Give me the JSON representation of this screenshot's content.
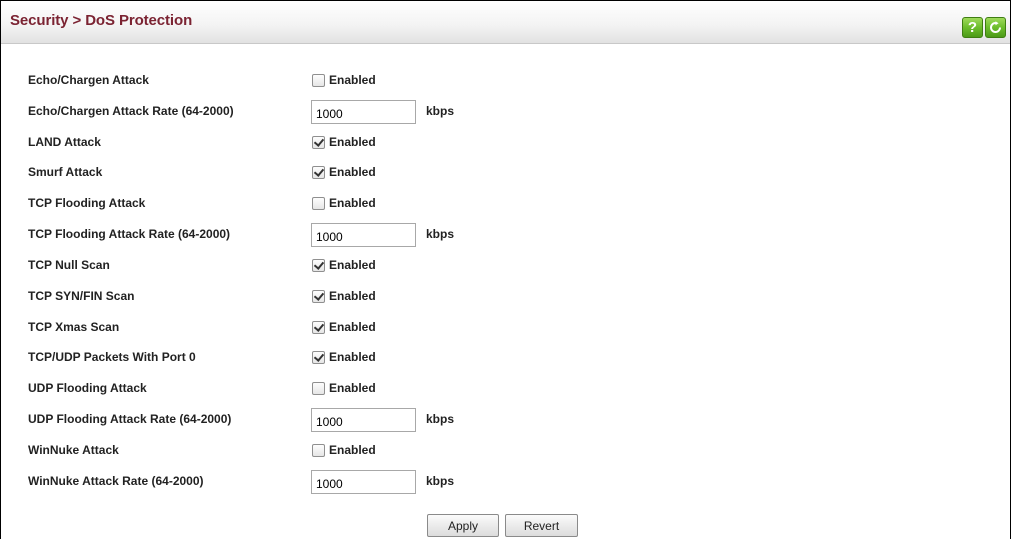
{
  "header": {
    "title": "Security > DoS Protection",
    "help_glyph": "?",
    "help_icon": "help-icon",
    "refresh_icon": "refresh-icon",
    "accent_color": "#7b2332",
    "button_color": "#6cbd2c"
  },
  "rows": [
    {
      "label": "Echo/Chargen Attack",
      "type": "checkbox",
      "checked": false,
      "option": "Enabled"
    },
    {
      "label": "Echo/Chargen Attack Rate (64-2000)",
      "type": "rate",
      "value": "1000",
      "unit": "kbps"
    },
    {
      "label": "LAND Attack",
      "type": "checkbox",
      "checked": true,
      "option": "Enabled"
    },
    {
      "label": "Smurf Attack",
      "type": "checkbox",
      "checked": true,
      "option": "Enabled"
    },
    {
      "label": "TCP Flooding Attack",
      "type": "checkbox",
      "checked": false,
      "option": "Enabled"
    },
    {
      "label": "TCP Flooding Attack Rate (64-2000)",
      "type": "rate",
      "value": "1000",
      "unit": "kbps"
    },
    {
      "label": "TCP Null Scan",
      "type": "checkbox",
      "checked": true,
      "option": "Enabled"
    },
    {
      "label": "TCP SYN/FIN Scan",
      "type": "checkbox",
      "checked": true,
      "option": "Enabled"
    },
    {
      "label": "TCP Xmas Scan",
      "type": "checkbox",
      "checked": true,
      "option": "Enabled"
    },
    {
      "label": "TCP/UDP Packets With Port 0",
      "type": "checkbox",
      "checked": true,
      "option": "Enabled"
    },
    {
      "label": "UDP Flooding Attack",
      "type": "checkbox",
      "checked": false,
      "option": "Enabled"
    },
    {
      "label": "UDP Flooding Attack Rate (64-2000)",
      "type": "rate",
      "value": "1000",
      "unit": "kbps"
    },
    {
      "label": "WinNuke Attack",
      "type": "checkbox",
      "checked": false,
      "option": "Enabled"
    },
    {
      "label": "WinNuke Attack Rate (64-2000)",
      "type": "rate",
      "value": "1000",
      "unit": "kbps"
    }
  ],
  "actions": {
    "apply_label": "Apply",
    "revert_label": "Revert"
  }
}
